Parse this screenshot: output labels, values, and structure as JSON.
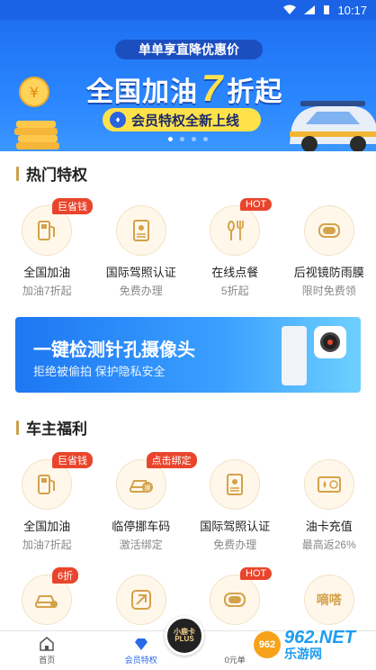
{
  "status_bar": {
    "time": "10:17"
  },
  "banner": {
    "top_tag": "单单享直降优惠价",
    "title_before": "全国加油",
    "title_big": "7",
    "title_after": "折起",
    "subtitle": "会员特权全新上线"
  },
  "hot_section": {
    "title": "热门特权",
    "items": [
      {
        "name": "全国加油",
        "desc": "加油7折起",
        "badge": "巨省钱",
        "icon": "fuel-pump-icon"
      },
      {
        "name": "国际驾照认证",
        "desc": "免费办理",
        "badge": "",
        "icon": "license-card-icon"
      },
      {
        "name": "在线点餐",
        "desc": "5折起",
        "badge": "HOT",
        "icon": "dining-icon"
      },
      {
        "name": "后视镜防雨膜",
        "desc": "限时免费领",
        "badge": "",
        "icon": "mirror-film-icon"
      }
    ]
  },
  "ad": {
    "title": "一键检测针孔摄像头",
    "subtitle": "拒绝被偷拍  保护隐私安全"
  },
  "owner_section": {
    "title": "车主福利",
    "items": [
      {
        "name": "全国加油",
        "desc": "加油7折起",
        "badge": "巨省钱",
        "icon": "fuel-pump-icon"
      },
      {
        "name": "临停挪车码",
        "desc": "激活绑定",
        "badge": "点击绑定",
        "icon": "move-car-icon"
      },
      {
        "name": "国际驾照认证",
        "desc": "免费办理",
        "badge": "",
        "icon": "license-card-icon"
      },
      {
        "name": "油卡充值",
        "desc": "最高返26%",
        "badge": "",
        "icon": "fuel-card-icon"
      }
    ],
    "row2": [
      {
        "badge": "6折",
        "icon": "car-repair-icon"
      },
      {
        "badge": "",
        "icon": "maintenance-icon"
      },
      {
        "badge": "HOT",
        "icon": "mirror-film-icon"
      },
      {
        "badge": "",
        "label": "嘀嗒",
        "icon": "didi-icon"
      }
    ]
  },
  "tabbar": {
    "tabs": [
      {
        "label": "首页"
      },
      {
        "label": "会员特权"
      },
      {
        "label": "0元单"
      },
      {
        "label": ""
      }
    ],
    "plus": {
      "line1": "小鹿卡",
      "line2": "PLUS"
    }
  },
  "watermark": {
    "logo": "962",
    "top": "962.NET",
    "bottom": "乐游网"
  },
  "colors": {
    "brand_blue": "#1a63e6",
    "gold": "#c8a24c",
    "badge_red": "#e9452c"
  }
}
